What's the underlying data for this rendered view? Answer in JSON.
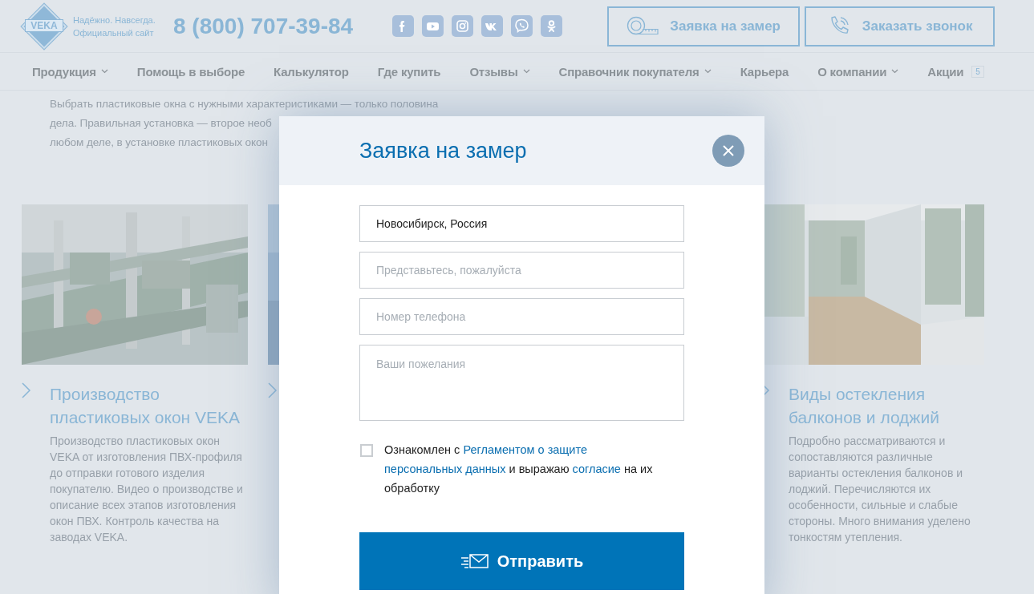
{
  "header": {
    "logo_text": "VEKA",
    "tagline": [
      "Надёжно. Навсегда.",
      "Официальный сайт"
    ],
    "phone": "8 (800) 707-39-84",
    "social": [
      {
        "kind": "facebook"
      },
      {
        "kind": "youtube"
      },
      {
        "kind": "instagram"
      },
      {
        "kind": "vk"
      },
      {
        "kind": "viber"
      },
      {
        "kind": "ok"
      }
    ],
    "buttons": [
      {
        "kind": "measure",
        "label": "Заявка на замер"
      },
      {
        "kind": "call",
        "label": "Заказать звонок"
      }
    ]
  },
  "nav": {
    "items": [
      {
        "label": "Продукция",
        "dropdown": true
      },
      {
        "label": "Помощь в выборе",
        "dropdown": false
      },
      {
        "label": "Калькулятор",
        "dropdown": false
      },
      {
        "label": "Где купить",
        "dropdown": false
      },
      {
        "label": "Отзывы",
        "dropdown": true
      },
      {
        "label": "Справочник покупателя",
        "dropdown": true
      },
      {
        "label": "Карьера",
        "dropdown": false
      },
      {
        "label": "О компании",
        "dropdown": true
      },
      {
        "label": "Акции",
        "dropdown": false,
        "badge": "5"
      }
    ]
  },
  "intro": [
    "Выбрать пластиковые окна с нужными характеристиками — только половина",
    "дела. Правильная установка — второе необ",
    "любом деле, в установке пластиковых окон"
  ],
  "cards": [
    {
      "picture": {
        "kind": "picture"
      },
      "title": "Производство пластиковых окон VEKA",
      "text": "Производство пластиковых окон VEKA от изготовления ПВХ-профиля до отправки готового изделия покупателю. Видео о производстве и описание всех этапов изготовления окон ПВХ. Контроль качества на заводах VEKA."
    },
    {
      "picture": {
        "kind": "picture"
      }
    },
    {
      "picture": {
        "kind": "picture"
      },
      "title": "Виды остекления балконов и лоджий",
      "text": "Подробно рассматриваются и сопоставляются различные варианты остекления балконов и лоджий. Перечисляются их особенности, сильные и слабые стороны. Много внимания уделено тонкостям утепления."
    }
  ],
  "modal": {
    "title": "Заявка на замер",
    "fields": [
      {
        "kind": "input",
        "value": "Новосибирск, Россия"
      },
      {
        "kind": "input",
        "placeholder": "Представьтесь, пожалуйста"
      },
      {
        "kind": "input",
        "placeholder": "Номер телефона"
      },
      {
        "kind": "textarea",
        "placeholder": "Ваши пожелания"
      }
    ],
    "consent": {
      "checked": false,
      "parts": [
        {
          "kind": "text",
          "text": "Ознакомлен с "
        },
        {
          "kind": "link",
          "text": "Регламентом о защите "
        },
        {
          "kind": "link",
          "text": "персональных данных"
        },
        {
          "kind": "text",
          "text": " и выражаю "
        },
        {
          "kind": "link",
          "text": "согласие"
        },
        {
          "kind": "text",
          "text": " на их обработку"
        }
      ]
    },
    "submit": "Отправить"
  }
}
